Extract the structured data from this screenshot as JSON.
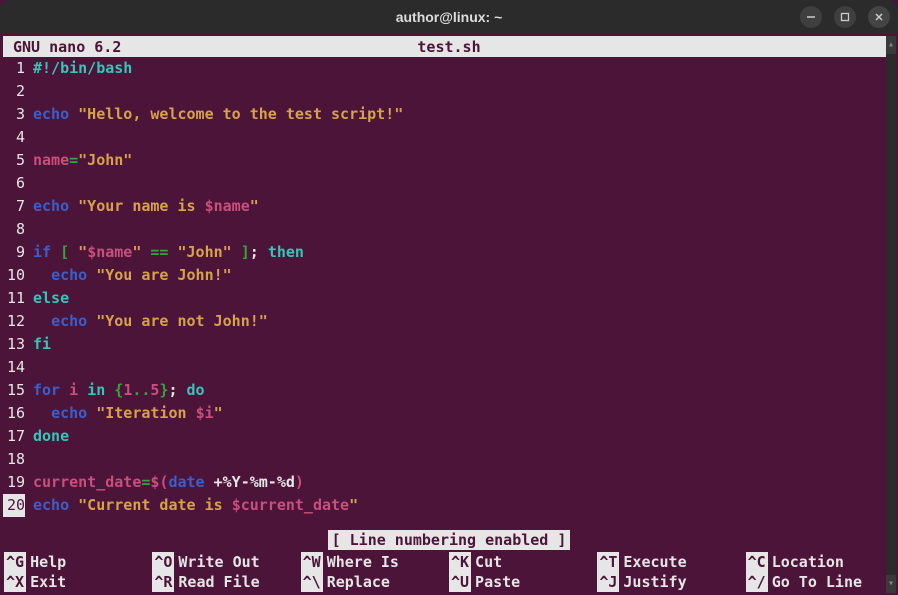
{
  "window": {
    "title": "author@linux: ~"
  },
  "header": {
    "app": "GNU nano 6.2",
    "filename": "test.sh"
  },
  "lines": [
    {
      "n": "1",
      "seg": [
        {
          "c": "c-sh",
          "t": "#!/bin/bash"
        }
      ]
    },
    {
      "n": "2",
      "seg": []
    },
    {
      "n": "3",
      "seg": [
        {
          "c": "c-cmd",
          "t": "echo"
        },
        {
          "c": "c-pl",
          "t": " "
        },
        {
          "c": "c-str",
          "t": "\"Hello, welcome to the test script!\""
        }
      ]
    },
    {
      "n": "4",
      "seg": []
    },
    {
      "n": "5",
      "seg": [
        {
          "c": "c-var",
          "t": "name"
        },
        {
          "c": "c-brk",
          "t": "="
        },
        {
          "c": "c-str",
          "t": "\"John\""
        }
      ]
    },
    {
      "n": "6",
      "seg": []
    },
    {
      "n": "7",
      "seg": [
        {
          "c": "c-cmd",
          "t": "echo"
        },
        {
          "c": "c-pl",
          "t": " "
        },
        {
          "c": "c-str",
          "t": "\"Your name is "
        },
        {
          "c": "c-var",
          "t": "$name"
        },
        {
          "c": "c-str",
          "t": "\""
        }
      ]
    },
    {
      "n": "8",
      "seg": []
    },
    {
      "n": "9",
      "seg": [
        {
          "c": "c-cmd",
          "t": "if"
        },
        {
          "c": "c-pl",
          "t": " "
        },
        {
          "c": "c-brk",
          "t": "["
        },
        {
          "c": "c-pl",
          "t": " "
        },
        {
          "c": "c-str",
          "t": "\""
        },
        {
          "c": "c-var",
          "t": "$name"
        },
        {
          "c": "c-str",
          "t": "\""
        },
        {
          "c": "c-pl",
          "t": " "
        },
        {
          "c": "c-brk",
          "t": "=="
        },
        {
          "c": "c-pl",
          "t": " "
        },
        {
          "c": "c-str",
          "t": "\"John\""
        },
        {
          "c": "c-pl",
          "t": " "
        },
        {
          "c": "c-brk",
          "t": "]"
        },
        {
          "c": "c-pl",
          "t": "; "
        },
        {
          "c": "c-kw",
          "t": "then"
        }
      ]
    },
    {
      "n": "10",
      "seg": [
        {
          "c": "c-pl",
          "t": "  "
        },
        {
          "c": "c-cmd",
          "t": "echo"
        },
        {
          "c": "c-pl",
          "t": " "
        },
        {
          "c": "c-str",
          "t": "\"You are John!\""
        }
      ]
    },
    {
      "n": "11",
      "seg": [
        {
          "c": "c-kw",
          "t": "else"
        }
      ]
    },
    {
      "n": "12",
      "seg": [
        {
          "c": "c-pl",
          "t": "  "
        },
        {
          "c": "c-cmd",
          "t": "echo"
        },
        {
          "c": "c-pl",
          "t": " "
        },
        {
          "c": "c-str",
          "t": "\"You are not John!\""
        }
      ]
    },
    {
      "n": "13",
      "seg": [
        {
          "c": "c-kw",
          "t": "fi"
        }
      ]
    },
    {
      "n": "14",
      "seg": []
    },
    {
      "n": "15",
      "seg": [
        {
          "c": "c-cmd",
          "t": "for"
        },
        {
          "c": "c-pl",
          "t": " "
        },
        {
          "c": "c-var",
          "t": "i"
        },
        {
          "c": "c-pl",
          "t": " "
        },
        {
          "c": "c-kw",
          "t": "in"
        },
        {
          "c": "c-pl",
          "t": " "
        },
        {
          "c": "c-brk",
          "t": "{"
        },
        {
          "c": "c-num",
          "t": "1"
        },
        {
          "c": "c-brk",
          "t": ".."
        },
        {
          "c": "c-num",
          "t": "5"
        },
        {
          "c": "c-brk",
          "t": "}"
        },
        {
          "c": "c-pl",
          "t": "; "
        },
        {
          "c": "c-kw",
          "t": "do"
        }
      ]
    },
    {
      "n": "16",
      "seg": [
        {
          "c": "c-pl",
          "t": "  "
        },
        {
          "c": "c-cmd",
          "t": "echo"
        },
        {
          "c": "c-pl",
          "t": " "
        },
        {
          "c": "c-str",
          "t": "\"Iteration "
        },
        {
          "c": "c-var",
          "t": "$i"
        },
        {
          "c": "c-str",
          "t": "\""
        }
      ]
    },
    {
      "n": "17",
      "seg": [
        {
          "c": "c-kw",
          "t": "done"
        }
      ]
    },
    {
      "n": "18",
      "seg": []
    },
    {
      "n": "19",
      "seg": [
        {
          "c": "c-var",
          "t": "current_date"
        },
        {
          "c": "c-brk",
          "t": "="
        },
        {
          "c": "c-var",
          "t": "$("
        },
        {
          "c": "c-cmd",
          "t": "date"
        },
        {
          "c": "c-pl",
          "t": " +%Y-%m-%d"
        },
        {
          "c": "c-var",
          "t": ")"
        }
      ]
    },
    {
      "n": "20",
      "seg": [
        {
          "c": "c-cmd",
          "t": "echo"
        },
        {
          "c": "c-pl",
          "t": " "
        },
        {
          "c": "c-str",
          "t": "\"Current date is "
        },
        {
          "c": "c-var",
          "t": "$current_date"
        },
        {
          "c": "c-str",
          "t": "\""
        }
      ]
    }
  ],
  "current_line": "20",
  "status": "[ Line numbering enabled ]",
  "shortcuts": [
    {
      "key": "^G",
      "label": "Help"
    },
    {
      "key": "^O",
      "label": "Write Out"
    },
    {
      "key": "^W",
      "label": "Where Is"
    },
    {
      "key": "^K",
      "label": "Cut"
    },
    {
      "key": "^T",
      "label": "Execute"
    },
    {
      "key": "^C",
      "label": "Location"
    },
    {
      "key": "^X",
      "label": "Exit"
    },
    {
      "key": "^R",
      "label": "Read File"
    },
    {
      "key": "^\\",
      "label": "Replace"
    },
    {
      "key": "^U",
      "label": "Paste"
    },
    {
      "key": "^J",
      "label": "Justify"
    },
    {
      "key": "^/",
      "label": "Go To Line"
    }
  ]
}
